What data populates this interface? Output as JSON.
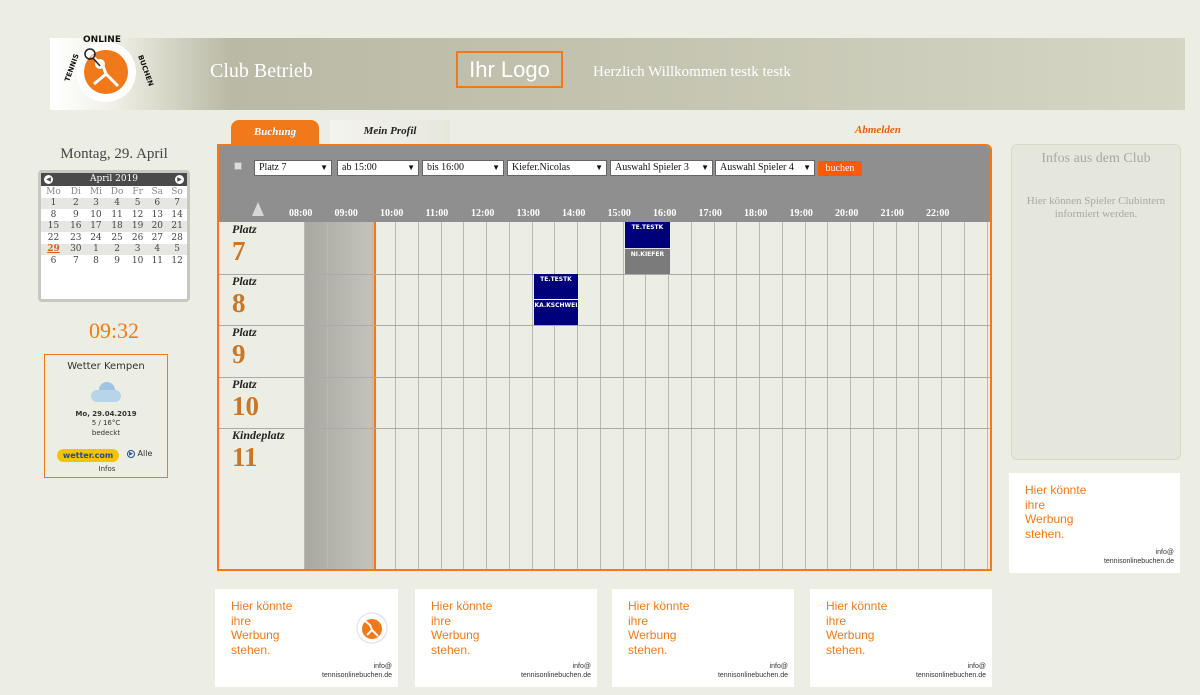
{
  "header": {
    "logo_text": {
      "top": "ONLINE",
      "left": "TENNIS",
      "right": "BUCHEN"
    },
    "title": "Club Betrieb",
    "logo_placeholder": "Ihr Logo",
    "welcome": "Herzlich Willkommen testk testk"
  },
  "left": {
    "date": "Montag, 29. April",
    "calendar": {
      "month": "April 2019",
      "weekdays": [
        "Mo",
        "Di",
        "Mi",
        "Do",
        "Fr",
        "Sa",
        "So"
      ],
      "weeks": [
        [
          "1",
          "2",
          "3",
          "4",
          "5",
          "6",
          "7"
        ],
        [
          "8",
          "9",
          "10",
          "11",
          "12",
          "13",
          "14"
        ],
        [
          "15",
          "16",
          "17",
          "18",
          "19",
          "20",
          "21"
        ],
        [
          "22",
          "23",
          "24",
          "25",
          "26",
          "27",
          "28"
        ],
        [
          "29",
          "30",
          "1",
          "2",
          "3",
          "4",
          "5"
        ],
        [
          "6",
          "7",
          "8",
          "9",
          "10",
          "11",
          "12"
        ]
      ],
      "today": "29"
    },
    "clock": "09:32",
    "weather": {
      "title": "Wetter Kempen",
      "icon": "cloud-icon",
      "date": "Mo, 29.04.2019",
      "temp": "5 / 16°C",
      "condition": "bedeckt",
      "brand": "wetter.com",
      "all_label": "Alle",
      "infos_label": "Infos"
    }
  },
  "tabs": {
    "buchung": "Buchung",
    "profil": "Mein Profil",
    "abmelden": "Abmelden"
  },
  "toolbar": {
    "court_select": "Platz 7",
    "from_select": "ab  15:00",
    "to_select": "bis  16:00",
    "player1_select": "Kiefer.Nicolas",
    "player3_select": "Auswahl Spieler 3",
    "player4_select": "Auswahl Spieler 4",
    "book_button": "buchen"
  },
  "schedule": {
    "hours": [
      "08:00",
      "09:00",
      "10:00",
      "11:00",
      "12:00",
      "13:00",
      "14:00",
      "15:00",
      "16:00",
      "17:00",
      "18:00",
      "19:00",
      "20:00",
      "21:00",
      "22:00"
    ],
    "courts": [
      {
        "label": "Platz",
        "number": "7"
      },
      {
        "label": "Platz",
        "number": "8"
      },
      {
        "label": "Platz",
        "number": "9"
      },
      {
        "label": "Platz",
        "number": "10"
      },
      {
        "label": "Kindeplatz",
        "number": "11"
      }
    ],
    "bookings": [
      {
        "court": "7",
        "from": "15:00",
        "to": "16:00",
        "players": [
          "TE.TESTK",
          "NI.KIEFER"
        ]
      },
      {
        "court": "8",
        "from": "13:00",
        "to": "14:00",
        "players": [
          "TE.TESTK",
          "KA.KSCHWEI"
        ]
      }
    ]
  },
  "right": {
    "infos_title": "Infos aus dem Club",
    "infos_body": "Hier können Spieler Clubintern informiert werden."
  },
  "ads": [
    {
      "text": "Hier könnte ihre Werbung stehen.",
      "info_line1": "info@",
      "info_line2": "tennisonlinebuchen.de"
    },
    {
      "text": "Hier könnte ihre Werbung stehen.",
      "info_line1": "info@",
      "info_line2": "tennisonlinebuchen.de"
    },
    {
      "text": "Hier könnte ihre Werbung stehen.",
      "info_line1": "info@",
      "info_line2": "tennisonlinebuchen.de"
    },
    {
      "text": "Hier könnte ihre Werbung stehen.",
      "info_line1": "info@",
      "info_line2": "tennisonlinebuchen.de"
    },
    {
      "text": "Hier könnte ihre Werbung stehen.",
      "info_line1": "info@",
      "info_line2": "tennisonlinebuchen.de"
    }
  ],
  "colors": {
    "accent": "#f07a1a",
    "booking": "#00007a",
    "booking_grey": "#7b7b7b",
    "court_number": "#c8772a"
  }
}
